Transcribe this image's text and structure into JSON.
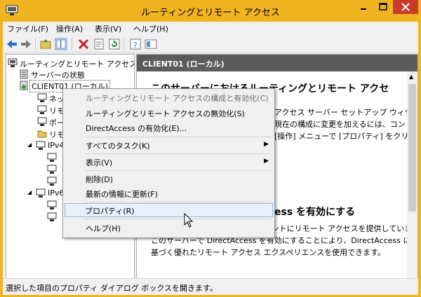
{
  "window": {
    "title": "ルーティングとリモート アクセス",
    "accent_color": "#f0b420",
    "close_color": "#c83c2c"
  },
  "menubar": {
    "items": [
      "ファイル(F)",
      "操作(A)",
      "表示(V)",
      "ヘルプ(H)"
    ]
  },
  "toolbar": {
    "icons": [
      "back-icon",
      "forward-icon",
      "up-folder-icon",
      "show-tree-icon",
      "delete-icon",
      "properties-icon",
      "refresh-icon",
      "help-icon",
      "console-icon"
    ]
  },
  "tree": {
    "items": [
      "ルーティングとリモート アクセス",
      "サーバーの状態",
      "CLIENT01 (ローカル)",
      "ネット",
      "リモー",
      "ポー",
      "リモー",
      "IPv4",
      "IPv6"
    ]
  },
  "right_pane": {
    "header": "CLIENT01 (ローカル)",
    "heading1": "このサーバーにおけるルーティングとリモート アクセ",
    "line1": "アクセス サーバー セットアップ ウィザー",
    "line2": "現在の構成に変更を加えるには、コン",
    "line3": "[操作] メニューで [プロパティ] をクリッ",
    "heading2": "ess を有効にする",
    "para1": "現在 VPN のみを使用してクライアントにリモート アクセスを提供しています。",
    "para2": "このサーバーで DirectAccess を有効にすることにより、DirectAccess に",
    "para3": "基づく優れたリモート アクセス エクスペリエンスを使用できます。"
  },
  "context_menu": {
    "items": [
      {
        "label": "ルーティングとリモート アクセスの構成と有効化(C)",
        "disabled": true
      },
      {
        "label": "ルーティングとリモート アクセスの無効化(S)"
      },
      {
        "label": "DirectAccess の有効化(E)..."
      },
      {
        "label": "すべてのタスク(K)",
        "submenu": true
      },
      {
        "label": "表示(V)",
        "submenu": true
      },
      {
        "label": "削除(D)"
      },
      {
        "label": "最新の情報に更新(F)"
      },
      {
        "label": "プロパティ(R)",
        "highlighted": true
      },
      {
        "label": "ヘルプ(H)"
      }
    ]
  },
  "statusbar": {
    "text": "選択した項目のプロパティ ダイアログ ボックスを開きます。"
  }
}
